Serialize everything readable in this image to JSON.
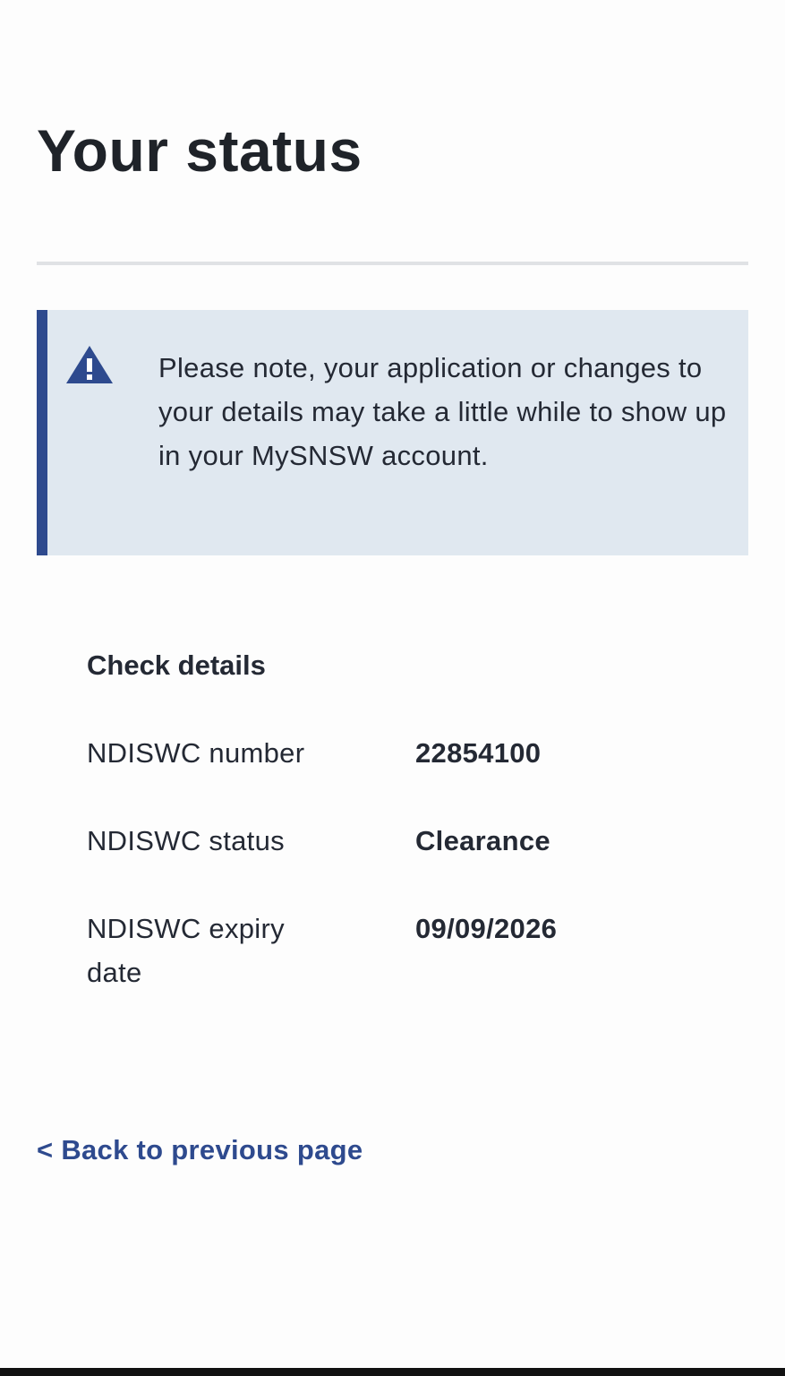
{
  "page": {
    "title": "Your status"
  },
  "notice": {
    "icon": "warning-icon",
    "text": "Please note, your application or changes to your details may take a little while to show up in your MySNSW account.",
    "accent_color": "#2e4a8e",
    "background_color": "#e0e8f0"
  },
  "check_details": {
    "heading": "Check details",
    "rows": [
      {
        "label": "NDISWC number",
        "value": "22854100"
      },
      {
        "label": "NDISWC status",
        "value": "Clearance"
      },
      {
        "label": "NDISWC expiry date",
        "value": "09/09/2026"
      }
    ]
  },
  "navigation": {
    "back_label": "< Back to previous page",
    "link_color": "#2e4a8e"
  }
}
